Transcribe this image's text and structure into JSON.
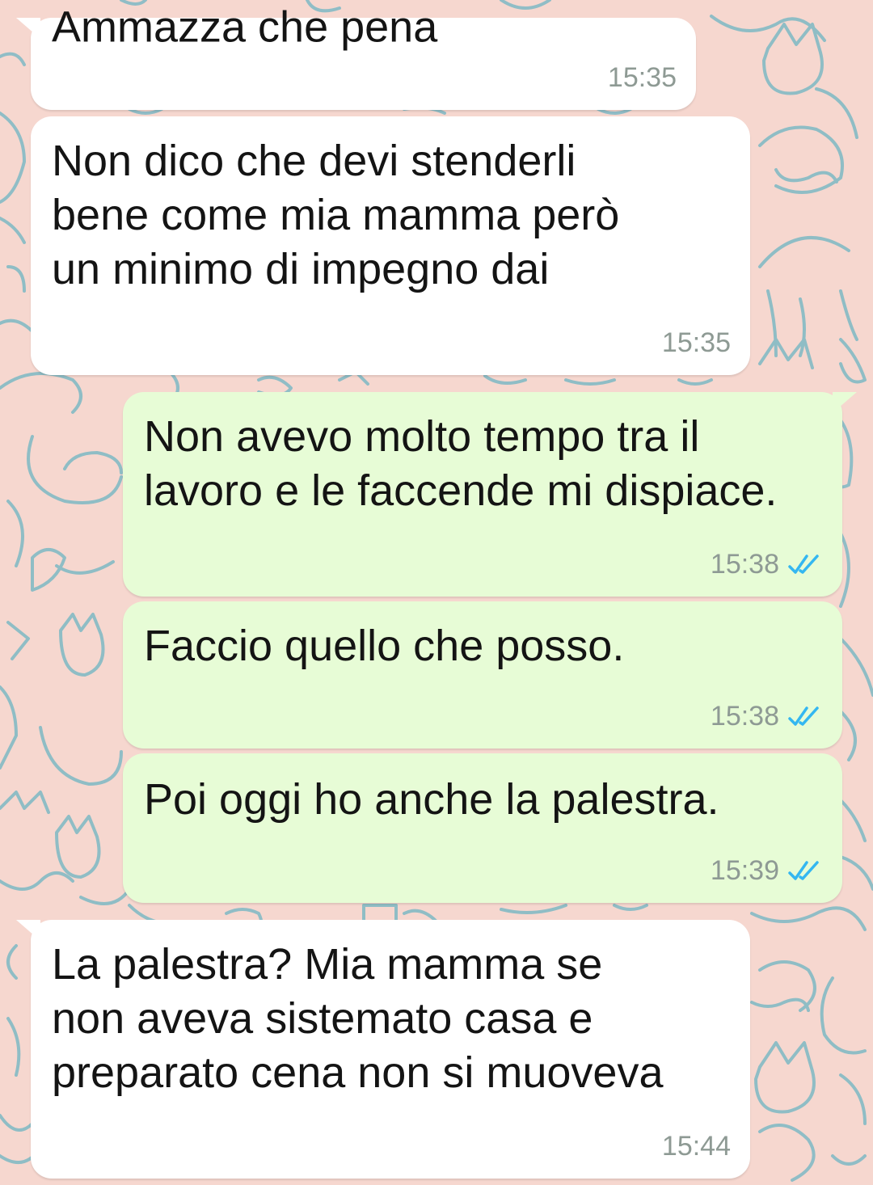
{
  "colors": {
    "background": "#f6d7cf",
    "incoming_bubble": "#ffffff",
    "outgoing_bubble": "#e7fcd6",
    "text": "#141414",
    "timestamp": "#8e9a94",
    "read_ticks": "#34b7f1",
    "pattern": "#7eb9c4"
  },
  "background": {
    "pattern_icon": "cat-doodle-icon"
  },
  "messages": [
    {
      "direction": "incoming",
      "text": "Ammazza che pena",
      "time": "15:35"
    },
    {
      "direction": "incoming",
      "text": "Non dico che devi stenderli\nbene come mia mamma però\nun minimo di impegno dai",
      "time": "15:35"
    },
    {
      "direction": "outgoing",
      "text": "Non avevo molto tempo tra il\nlavoro e le faccende mi dispiace.",
      "time": "15:38",
      "status_icon": "double-check-read-icon"
    },
    {
      "direction": "outgoing",
      "text": "Faccio quello che posso.",
      "time": "15:38",
      "status_icon": "double-check-read-icon"
    },
    {
      "direction": "outgoing",
      "text": "Poi oggi ho anche la palestra.",
      "time": "15:39",
      "status_icon": "double-check-read-icon"
    },
    {
      "direction": "incoming",
      "text": "La palestra? Mia mamma se\nnon aveva sistemato casa e\npreparato cena non si muoveva",
      "time": "15:44"
    }
  ]
}
